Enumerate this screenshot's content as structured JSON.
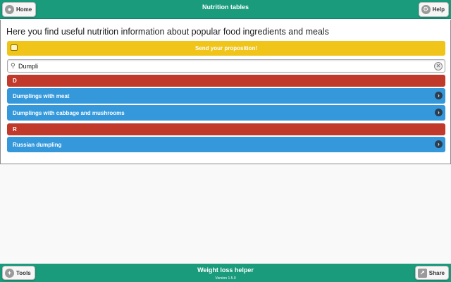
{
  "header": {
    "title": "Nutrition tables",
    "home_label": "Home",
    "help_label": "Help"
  },
  "main": {
    "heading": "Here you find useful nutrition information about popular food ingredients and meals",
    "propose_label": "Send your proposition!",
    "search": {
      "value": "Dumpli",
      "placeholder": ""
    },
    "groups": [
      {
        "letter": "D",
        "items": [
          "Dumplings with meat",
          "Dumplings with cabbage and mushrooms"
        ]
      },
      {
        "letter": "R",
        "items": [
          "Russian dumpling"
        ]
      }
    ]
  },
  "footer": {
    "title": "Weight loss helper",
    "version": "Version 1.5.0",
    "tools_label": "Tools",
    "share_label": "Share"
  },
  "colors": {
    "bar": "#1a9b7c",
    "propose": "#f0c419",
    "divider": "#c0392b",
    "item": "#3498db"
  }
}
